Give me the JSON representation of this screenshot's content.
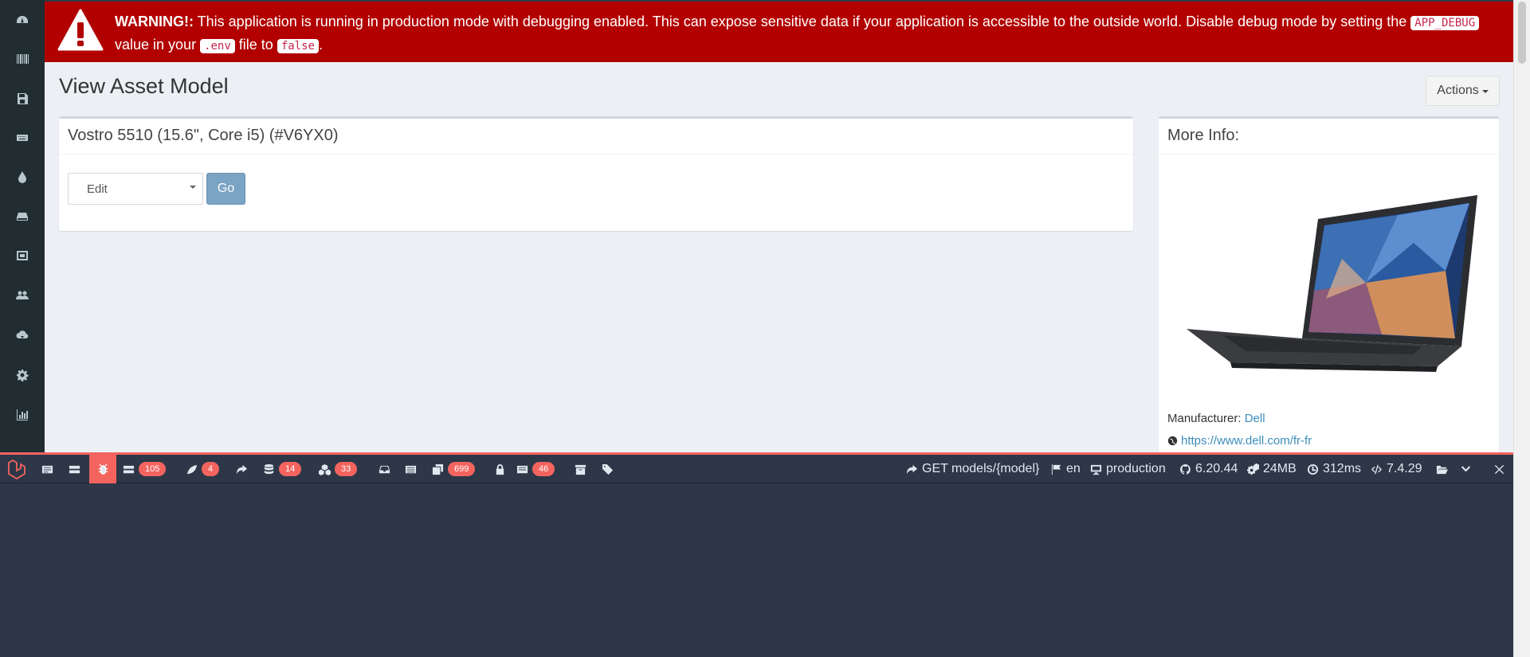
{
  "sidebar": {
    "icons": [
      "dashboard-icon",
      "barcode-icon",
      "save-icon",
      "keyboard-icon",
      "tint-icon",
      "hdd-icon",
      "server-icon",
      "users-icon",
      "cloud-download-icon",
      "gear-icon",
      "bar-chart-icon"
    ]
  },
  "warning": {
    "title": "WARNING!:",
    "text1": " This application is running in production mode with debugging enabled. This can expose sensitive data if your application is accessible to the outside world. Disable debug mode by setting the ",
    "code1": "APP_DEBUG",
    "text2": " value in your ",
    "code2": ".env",
    "text3": " file to ",
    "code3": "false",
    "text4": "."
  },
  "page": {
    "title": "View Asset Model",
    "actions_label": "Actions"
  },
  "model_box": {
    "title": "Vostro 5510 (15.6\", Core i5) (#V6YX0)",
    "select_value": "Edit",
    "go_label": "Go"
  },
  "info_box": {
    "title": "More Info:",
    "manufacturer_label": "Manufacturer:",
    "manufacturer_value": "Dell",
    "url": "https://www.dell.com/fr-fr"
  },
  "debugbar": {
    "badges": {
      "queries_views": "105",
      "messages": "4",
      "database": "14",
      "models": "33",
      "events": "699",
      "session": "46"
    },
    "route": "GET models/{model}",
    "locale": "en",
    "env": "production",
    "version": "6.20.44",
    "memory": "24MB",
    "time": "312ms",
    "php": "7.4.29"
  },
  "colors": {
    "warning_bg": "#b20000",
    "debugbar_bg": "#2d3748",
    "debugbar_accent": "#f4645f",
    "sidebar_bg": "#222d32",
    "link": "#3c8dbc"
  }
}
